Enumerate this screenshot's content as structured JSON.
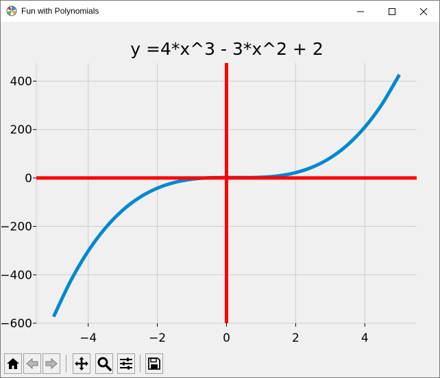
{
  "window": {
    "title": "Fun with Polynomials",
    "app_icon": "matplotlib-icon",
    "controls": [
      {
        "name": "minimize-button",
        "icon": "minimize-icon"
      },
      {
        "name": "maximize-button",
        "icon": "maximize-icon"
      },
      {
        "name": "close-button",
        "icon": "close-icon"
      }
    ]
  },
  "toolbar": {
    "buttons": [
      {
        "name": "home-button",
        "icon": "home-icon"
      },
      {
        "name": "back-button",
        "icon": "back-arrow-icon"
      },
      {
        "name": "forward-button",
        "icon": "forward-arrow-icon"
      },
      {
        "name": "pan-button",
        "icon": "move-icon"
      },
      {
        "name": "zoom-button",
        "icon": "magnifier-icon"
      },
      {
        "name": "configure-subplots-button",
        "icon": "sliders-icon"
      },
      {
        "name": "save-button",
        "icon": "save-icon"
      }
    ]
  },
  "chart_data": {
    "type": "line",
    "title": "y =4*x^3 - 3*x^2 + 2",
    "xlabel": "",
    "ylabel": "",
    "xlim": [
      -5.5,
      5.5
    ],
    "ylim": [
      -600,
      475
    ],
    "xticks": [
      -4,
      -2,
      0,
      2,
      4
    ],
    "xtick_labels": [
      "−4",
      "−2",
      "0",
      "2",
      "4"
    ],
    "yticks": [
      -600,
      -400,
      -200,
      0,
      200,
      400
    ],
    "ytick_labels": [
      "−600",
      "−400",
      "−200",
      "0",
      "200",
      "400"
    ],
    "grid": true,
    "series": [
      {
        "color": "#0088d1",
        "x": [
          -5,
          -4.5,
          -4,
          -3.5,
          -3,
          -2.5,
          -2,
          -1.5,
          -1,
          -0.5,
          0,
          0.5,
          1,
          1.5,
          2,
          2.5,
          3,
          3.5,
          4,
          4.5,
          5
        ],
        "y": [
          -573,
          -423.25,
          -302,
          -206.25,
          -133,
          -79.25,
          -42,
          -18.25,
          -5,
          0.75,
          2,
          1.75,
          3,
          8.75,
          22,
          45.75,
          83,
          136.75,
          210,
          305.75,
          427
        ]
      }
    ],
    "axis_lines": {
      "color": "#ff0000",
      "x_at": 0,
      "y_at": 0
    },
    "background": "#f0f0f0",
    "grid_color": "#cccccc"
  }
}
